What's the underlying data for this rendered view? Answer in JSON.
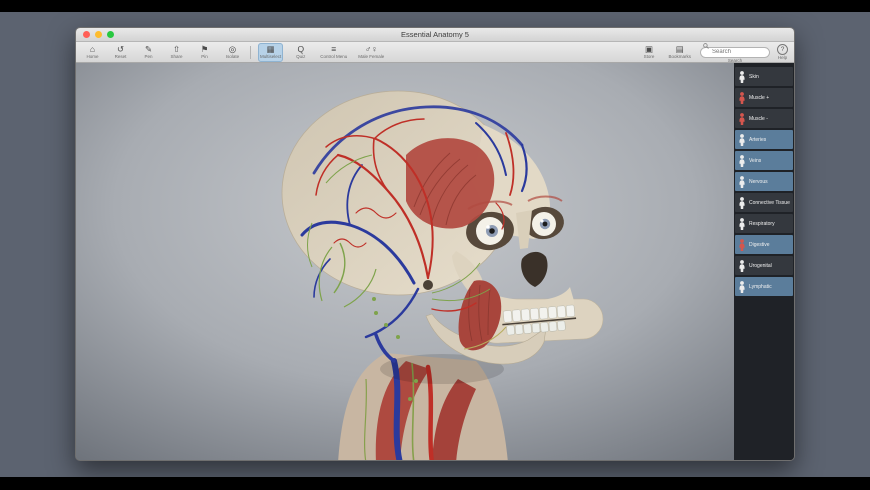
{
  "window": {
    "title": "Essential Anatomy 5"
  },
  "traffic_lights": {
    "close": "#ff5f57",
    "minimize": "#febc2e",
    "zoom": "#28c840"
  },
  "toolbar": {
    "items_left": [
      {
        "label": "Home",
        "glyph": "⌂"
      },
      {
        "label": "Reset",
        "glyph": "↺"
      },
      {
        "label": "Pen",
        "glyph": "✎"
      },
      {
        "label": "Share",
        "glyph": "⇧"
      },
      {
        "label": "Pin",
        "glyph": "⚑"
      },
      {
        "label": "Isolate",
        "glyph": "◎"
      },
      {
        "label": "Multiselect",
        "glyph": "▦"
      },
      {
        "label": "Quiz",
        "glyph": "Q"
      },
      {
        "label": "Control Menu",
        "glyph": "≡"
      },
      {
        "label": "Male Female",
        "glyph": "♂♀"
      }
    ],
    "items_right": [
      {
        "label": "Store",
        "glyph": "▣"
      },
      {
        "label": "Bookmarks",
        "glyph": "▤"
      }
    ],
    "search": {
      "placeholder": "Search",
      "caption": "Search"
    },
    "help": {
      "label": "Help",
      "glyph": "?"
    }
  },
  "sidebar": {
    "selected_color": "#5b7d9b",
    "unselected_color": "#34383e",
    "items": [
      {
        "label": "Skin",
        "selected": false,
        "icon_color": "#ececec"
      },
      {
        "label": "Muscle +",
        "selected": false,
        "icon_color": "#d4564e"
      },
      {
        "label": "Muscle -",
        "selected": false,
        "icon_color": "#d4564e"
      },
      {
        "label": "Arteries",
        "selected": true,
        "icon_color": "#ececec"
      },
      {
        "label": "Veins",
        "selected": true,
        "icon_color": "#ececec"
      },
      {
        "label": "Nervous",
        "selected": true,
        "icon_color": "#ececec"
      },
      {
        "label": "Connective Tissue",
        "selected": false,
        "icon_color": "#ececec"
      },
      {
        "label": "Respiratory",
        "selected": false,
        "icon_color": "#ececec"
      },
      {
        "label": "Digestive",
        "selected": true,
        "icon_color": "#d4564e"
      },
      {
        "label": "Urogenital",
        "selected": false,
        "icon_color": "#ececec"
      },
      {
        "label": "Lymphatic",
        "selected": true,
        "icon_color": "#ececec"
      }
    ]
  },
  "model_colors": {
    "bone": "#d9cfbd",
    "artery": "#bf2f27",
    "vein": "#2b3a9d",
    "nerve": "#7ea34b",
    "muscle": "#ad4a40"
  }
}
